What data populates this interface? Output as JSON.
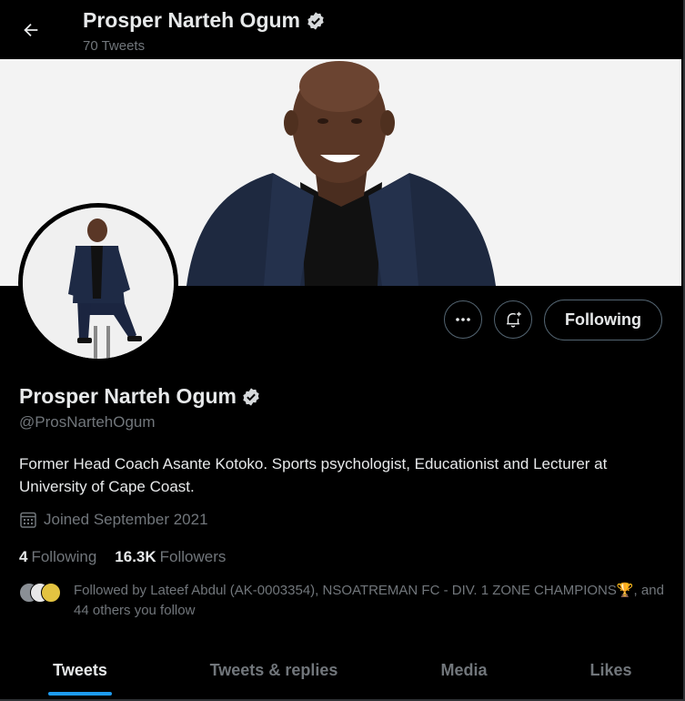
{
  "header": {
    "name": "Prosper Narteh Ogum",
    "tweet_count": "70 Tweets"
  },
  "profile": {
    "name": "Prosper Narteh Ogum",
    "handle": "@ProsNartehOgum",
    "bio": "Former Head Coach Asante Kotoko. Sports psychologist, Educationist and Lecturer at University of Cape Coast.",
    "joined": "Joined September 2021",
    "following_count": "4",
    "following_label": "Following",
    "followers_count": "16.3K",
    "followers_label": "Followers",
    "followed_by": "Followed by Lateef Abdul (AK-0003354), NSOATREMAN FC - DIV. 1 ZONE CHAMPIONS🏆, and 44 others you follow"
  },
  "actions": {
    "follow_label": "Following"
  },
  "tabs": [
    {
      "label": "Tweets",
      "active": true
    },
    {
      "label": "Tweets & replies",
      "active": false
    },
    {
      "label": "Media",
      "active": false
    },
    {
      "label": "Likes",
      "active": false
    }
  ],
  "colors": {
    "accent": "#1d9bf0",
    "text_primary": "#e7e9ea",
    "text_secondary": "#71767b",
    "background": "#000000"
  },
  "icons": {
    "back": "arrow-left-icon",
    "verified": "verified-badge-icon",
    "more": "more-dots-icon",
    "notify": "bell-plus-icon",
    "calendar": "calendar-icon"
  }
}
